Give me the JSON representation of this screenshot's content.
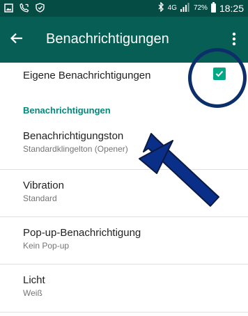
{
  "status_bar": {
    "left_icons": [
      "image-icon",
      "phone-call-icon",
      "shield-check-icon"
    ],
    "network_label": "4G",
    "battery_percent": "72%",
    "time": "18:25"
  },
  "app_bar": {
    "back_icon": "arrow-left-icon",
    "title": "Benachrichtigungen",
    "menu_icon": "more-vertical-icon"
  },
  "own_notifications": {
    "label": "Eigene Benachrichtigungen",
    "checked": true
  },
  "section_title": "Benachrichtigungen",
  "items": [
    {
      "title": "Benachrichtigungston",
      "subtitle": "Standardklingelton (Opener)"
    },
    {
      "title": "Vibration",
      "subtitle": "Standard"
    },
    {
      "title": "Pop-up-Benachrichtigung",
      "subtitle": "Kein Pop-up"
    },
    {
      "title": "Licht",
      "subtitle": "Weiß"
    }
  ],
  "colors": {
    "status_bar": "#054d44",
    "app_bar": "#075e54",
    "accent": "#00897b",
    "checkbox": "#00a884",
    "annotation": "#0c2e6b"
  }
}
